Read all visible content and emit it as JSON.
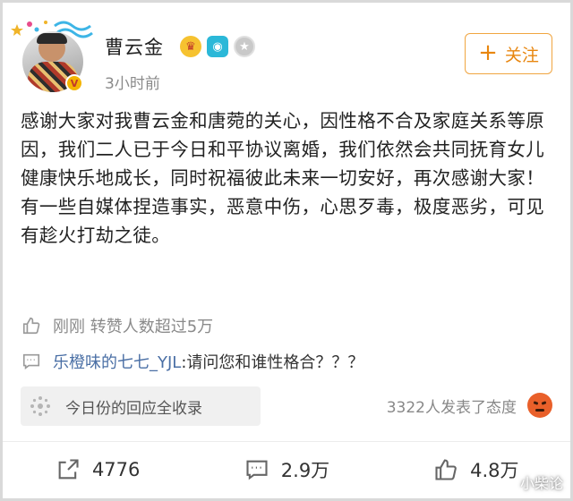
{
  "author": {
    "name": "曹云金",
    "time": "3小时前",
    "badges": [
      "crown-vip-icon",
      "camera-icon",
      "medal-icon"
    ],
    "verified_icon": "verified-badge-icon"
  },
  "follow_button": {
    "icon": "plus-icon",
    "label": "关注"
  },
  "post": {
    "paragraph_1": "感谢大家对我曹云金和唐菀的关心，因性格不合及家庭关系等原因，我们二人已于今日和平协议离婚，我们依然会共同抚育女儿健康快乐地成长，同时祝福彼此未来一切安好，再次感谢大家！",
    "paragraph_2": "有一些自媒体捏造事实，恶意中伤，心思歹毒，极度恶劣，可见有趁火打劫之徒。"
  },
  "likes_row": {
    "icon": "thumbs-up-icon",
    "text": "刚刚 转赞人数超过5万"
  },
  "comment_row": {
    "icon": "comment-icon",
    "user": "乐橙味的七七_YJL",
    "text": ":请问您和谁性格合？？？"
  },
  "topic": {
    "icon": "sparkle-icon",
    "label": "今日份的回应全收录"
  },
  "reactions": {
    "text": "3322人发表了态度",
    "icon": "angry-face-icon"
  },
  "actions": {
    "repost": {
      "icon": "share-icon",
      "count": "4776"
    },
    "comment": {
      "icon": "comment-icon",
      "count": "2.9万"
    },
    "like": {
      "icon": "thumbs-up-icon",
      "count": "4.8万"
    }
  },
  "watermark": "小柴论",
  "colors": {
    "accent_orange": "#e8860f",
    "link_blue": "#4a6fa5",
    "muted_gray": "#8a8a8a"
  }
}
